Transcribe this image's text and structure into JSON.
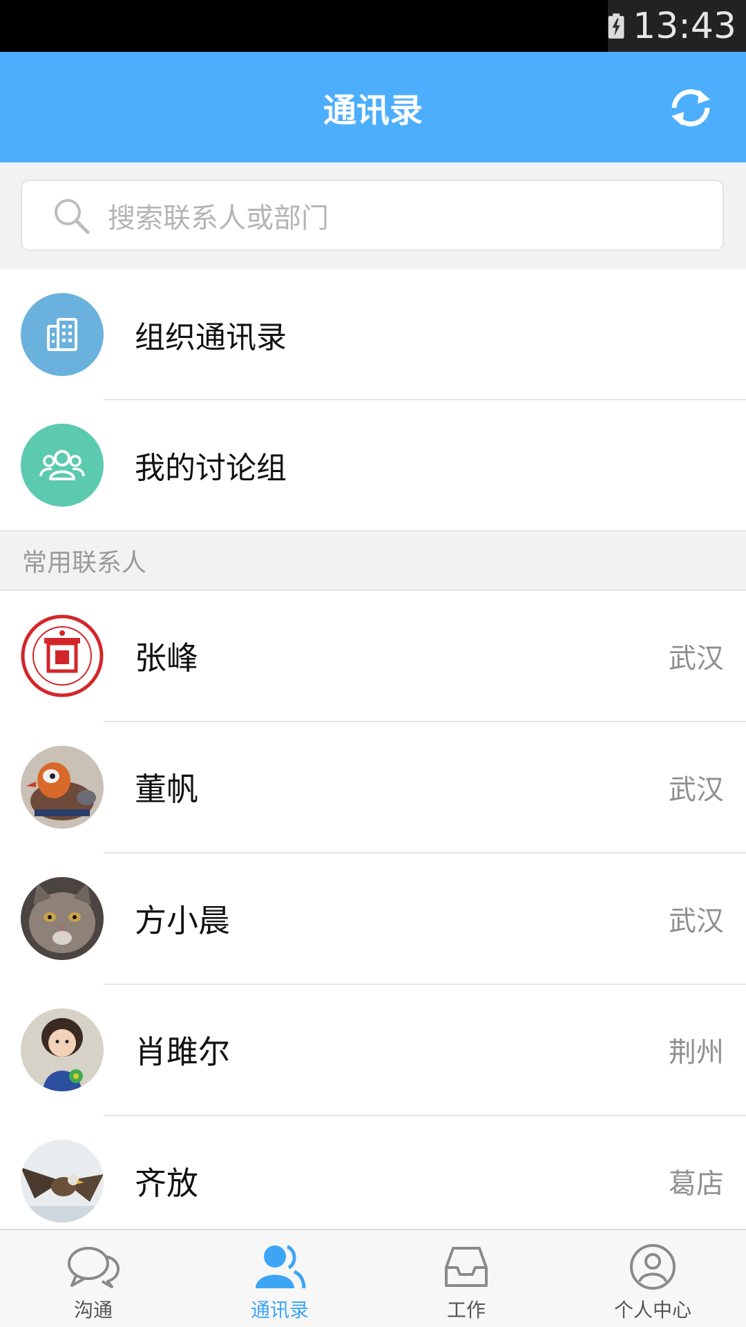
{
  "status_bar": {
    "time": "13:43"
  },
  "header": {
    "title": "通讯录"
  },
  "search": {
    "placeholder": "搜索联系人或部门"
  },
  "menu": [
    {
      "label": "组织通讯录",
      "icon": "building-icon",
      "color": "#6ab1dd"
    },
    {
      "label": "我的讨论组",
      "icon": "group-icon",
      "color": "#5ccaae"
    }
  ],
  "section": {
    "frequent_contacts": "常用联系人"
  },
  "contacts": [
    {
      "name": "张峰",
      "city": "武汉",
      "avatar": "seal-logo"
    },
    {
      "name": "董帆",
      "city": "武汉",
      "avatar": "duck-photo"
    },
    {
      "name": "方小晨",
      "city": "武汉",
      "avatar": "cat-photo"
    },
    {
      "name": "肖雎尔",
      "city": "荆州",
      "avatar": "baby-photo"
    },
    {
      "name": "齐放",
      "city": "葛店",
      "avatar": "eagle-photo"
    }
  ],
  "tabs": [
    {
      "label": "沟通",
      "icon": "chat-icon",
      "active": false
    },
    {
      "label": "通讯录",
      "icon": "contacts-icon",
      "active": true
    },
    {
      "label": "工作",
      "icon": "inbox-icon",
      "active": false
    },
    {
      "label": "个人中心",
      "icon": "person-icon",
      "active": false
    }
  ],
  "colors": {
    "accent": "#4daefd",
    "active_tab": "#3ea5f5"
  }
}
